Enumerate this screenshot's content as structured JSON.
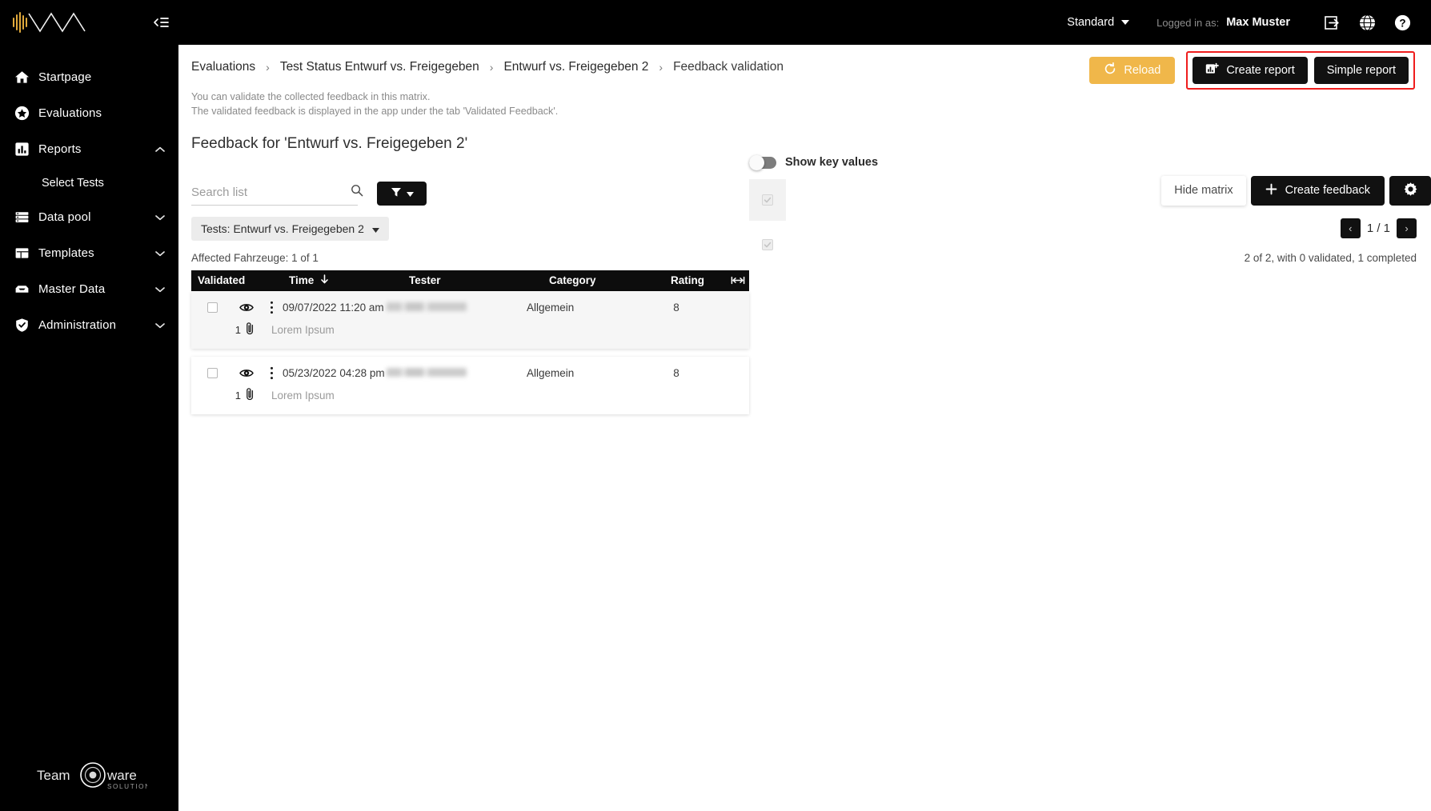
{
  "topbar": {
    "logo_alt": "NVA logo",
    "collapse_icon": "collapse-sidebar-icon",
    "environment": "Standard",
    "logged_in_label": "Logged in as:",
    "user_name": "Max Muster",
    "icons": [
      "logout-icon",
      "language-globe-icon",
      "help-icon"
    ]
  },
  "sidebar": {
    "items": [
      {
        "label": "Startpage",
        "icon": "home-icon",
        "chevron": ""
      },
      {
        "label": "Evaluations",
        "icon": "star-icon",
        "chevron": ""
      },
      {
        "label": "Reports",
        "icon": "chart-icon",
        "chevron": "up"
      },
      {
        "label": "Data pool",
        "icon": "database-icon",
        "chevron": "down"
      },
      {
        "label": "Templates",
        "icon": "layout-icon",
        "chevron": "down"
      },
      {
        "label": "Master Data",
        "icon": "inbox-icon",
        "chevron": "down"
      },
      {
        "label": "Administration",
        "icon": "shield-check-icon",
        "chevron": "down"
      }
    ],
    "sub_item": "Select Tests",
    "footer_logo": "Team ware SOLUTIONS"
  },
  "breadcrumb": {
    "items": [
      "Evaluations",
      "Test Status Entwurf vs. Freigegeben",
      "Entwurf vs. Freigegeben 2",
      "Feedback validation"
    ],
    "separator": "›"
  },
  "actions": {
    "reload_label": "Reload",
    "create_report_label": "Create report",
    "simple_report_label": "Simple report",
    "highlight_color": "#ef1d1d",
    "reload_color": "#f0b74a"
  },
  "content": {
    "hint_line1": "You can validate the collected feedback in this matrix.",
    "hint_line2": "The validated feedback is displayed in the app under the tab 'Validated Feedback'.",
    "page_title": "Feedback for 'Entwurf vs. Freigegeben 2'"
  },
  "toolbar": {
    "search_placeholder": "Search list",
    "search_value": "",
    "search_icon": "search-icon",
    "filter_icon": "filter-icon",
    "hide_matrix_label": "Hide matrix",
    "create_feedback_label": "Create feedback",
    "gear_icon": "gear-icon"
  },
  "filters": {
    "tests_chip": "Tests: Entwurf vs. Freigegeben 2",
    "pager_prev": "‹",
    "pager_next": "›",
    "pager_label": "1 / 1"
  },
  "summary": {
    "left": "Affected Fahrzeuge: 1 of 1",
    "right": "2 of 2, with 0 validated, 1 completed"
  },
  "table": {
    "columns": [
      "Validated",
      "Time",
      "Tester",
      "Category",
      "Rating"
    ],
    "sort_column": "Time",
    "sort_direction": "desc",
    "resize_icon": "resize-columns-icon",
    "rows": [
      {
        "validated": false,
        "time": "09/07/2022 11:20 am",
        "tester": "",
        "tester_redacted": true,
        "category": "Allgemein",
        "rating": "8",
        "attachments": "1",
        "comment": "Lorem Ipsum",
        "highlighted": true,
        "matrix_checked": true
      },
      {
        "validated": false,
        "time": "05/23/2022 04:28 pm",
        "tester": "",
        "tester_redacted": true,
        "category": "Allgemein",
        "rating": "8",
        "attachments": "1",
        "comment": "Lorem Ipsum",
        "highlighted": false,
        "matrix_checked": true
      }
    ]
  },
  "matrix": {
    "toggle_label": "Show key values",
    "toggle_on": false
  }
}
